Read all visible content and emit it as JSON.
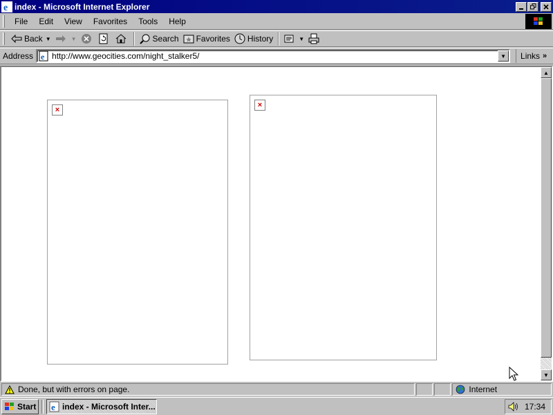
{
  "window": {
    "title": "index - Microsoft Internet Explorer"
  },
  "menu": {
    "items": [
      {
        "label": "File"
      },
      {
        "label": "Edit"
      },
      {
        "label": "View"
      },
      {
        "label": "Favorites"
      },
      {
        "label": "Tools"
      },
      {
        "label": "Help"
      }
    ]
  },
  "toolbar": {
    "back_label": "Back",
    "search_label": "Search",
    "favorites_label": "Favorites",
    "history_label": "History"
  },
  "address": {
    "label": "Address",
    "url": "http://www.geocities.com/night_stalker5/",
    "links_label": "Links"
  },
  "status": {
    "message": "Done, but with errors on page.",
    "zone": "Internet"
  },
  "taskbar": {
    "start_label": "Start",
    "task_label": "index - Microsoft Inter...",
    "clock": "17:34"
  },
  "colors": {
    "titlebar": "#000080",
    "chrome": "#c0c0c0",
    "broken_image_x": "#d00000"
  }
}
